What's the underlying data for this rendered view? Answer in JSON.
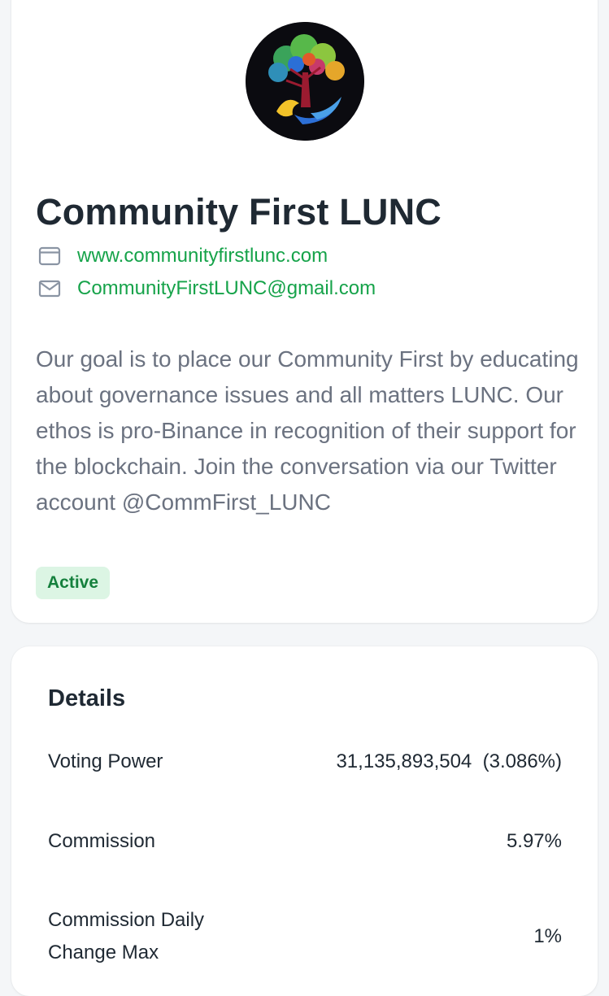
{
  "profile": {
    "name": "Community First LUNC",
    "website": "www.communityfirstlunc.com",
    "email": "CommunityFirstLUNC@gmail.com",
    "description": "Our goal is to place our Community First by educating about governance issues and all matters LUNC. Our ethos is pro-Binance in recognition of their support for the blockchain. Join the conversation via our Twitter account @CommFirst_LUNC",
    "status": "Active",
    "icons": {
      "website": "browser-window-icon",
      "email": "envelope-icon"
    },
    "colors": {
      "link": "#16a34a",
      "badge_bg": "#dcf5e4",
      "badge_text": "#15803d"
    }
  },
  "details": {
    "title": "Details",
    "voting_power_label": "Voting Power",
    "voting_power_value": "31,135,893,504  (3.086%)",
    "commission_label": "Commission",
    "commission_value": "5.97%",
    "change_max_label": "Commission Daily Change Max",
    "change_max_value": "1%"
  }
}
